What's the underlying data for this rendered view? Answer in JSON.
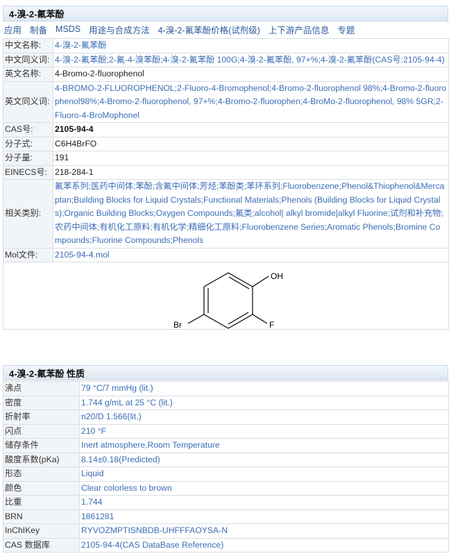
{
  "header1": {
    "title": "4-溴-2-氟苯酚"
  },
  "nav": [
    "应用",
    "制备",
    "MSDS",
    "用途与合成方法",
    "4-溴-2-氟苯酚价格(试剂级)",
    "上下游产品信息",
    "专题"
  ],
  "basic": [
    {
      "key": "中文名称:",
      "value": "4-溴-2-氟苯酚",
      "style": "blue"
    },
    {
      "key": "中文同义词:",
      "value": "4-溴-2-氟苯酚;2-氟-4-溴苯酚;4-溴-2-氟苯酚 100G;4-溴-2-氟苯酚, 97+%;4-溴-2-氟苯酚(CAS号:2105-94-4)",
      "style": "blue"
    },
    {
      "key": "英文名称:",
      "value": "4-Bromo-2-fluorophenol",
      "style": "dark"
    },
    {
      "key": "英文同义词:",
      "value": "4-BROMO-2-FLUOROPHENOL;2-Fluoro-4-Bromophenol;4-Bromo-2-fluorophenol 98%;4-Bromo-2-fluorophenol98%;4-Bromo-2-fluorophenol, 97+%;4-Bromo-2-fluorophen;4-BroMo-2-fluorophenol, 98% 5GR;2-Fluoro-4-BroMophonel",
      "style": "blue"
    },
    {
      "key": "CAS号:",
      "value": "2105-94-4",
      "style": "bold"
    },
    {
      "key": "分子式:",
      "value": "C6H4BrFO",
      "style": "dark"
    },
    {
      "key": "分子量:",
      "value": "191",
      "style": "dark"
    },
    {
      "key": "EINECS号:",
      "value": "218-284-1",
      "style": "dark"
    },
    {
      "key": "相关类别:",
      "value": "氟苯系列;医药中间体;苯酚;含氟中间体;芳烃;苯酚类;苯环系列;Fluorobenzene;Phenol&Thiophenol&Mercaptan;Building Blocks for Liquid Crystals;Functional Materials;Phenols (Building Blocks for Liquid Crystals);Organic Building Blocks;Oxygen Compounds;氟类;alcohol| alkyl bromide|alkyl Fluorine;试剂和补充物;农药中间体;有机化工原料;有机化学;精细化工原料;Fluorobenzene Series;Aromatic Phenols;Bromine Compounds;Fluorine Compounds;Phenols",
      "style": "blue"
    },
    {
      "key": "Mol文件:",
      "value": "2105-94-4.mol",
      "style": "link"
    }
  ],
  "structure": {
    "oh": "OH",
    "br": "Br",
    "f": "F"
  },
  "header2": {
    "title": "4-溴-2-氟苯酚 性质"
  },
  "props": [
    {
      "key": "沸点",
      "value": "79 °C/7 mmHg (lit.)"
    },
    {
      "key": "密度",
      "value": "1.744 g/mL at 25 °C (lit.)"
    },
    {
      "key": "折射率",
      "value": "n20/D 1.566(lit.)"
    },
    {
      "key": "闪点",
      "value": "210 °F"
    },
    {
      "key": "储存条件",
      "value": "Inert atmosphere,Room Temperature"
    },
    {
      "key": "酸度系数(pKa)",
      "value": "8.14±0.18(Predicted)"
    },
    {
      "key": "形态",
      "value": "Liquid"
    },
    {
      "key": "颜色",
      "value": "Clear colorless to brown"
    },
    {
      "key": "比重",
      "value": "1.744"
    },
    {
      "key": "BRN",
      "value": "1861281"
    },
    {
      "key": "InChIKey",
      "value": "RYVOZMPTISNBDB-UHFFFAOYSA-N"
    },
    {
      "key": "CAS 数据库",
      "value": "2105-94-4(CAS DataBase Reference)"
    }
  ]
}
